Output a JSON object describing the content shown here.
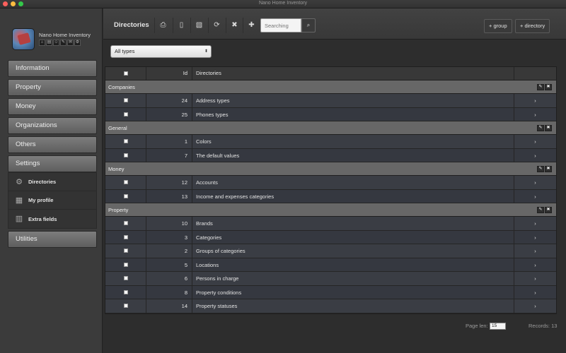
{
  "window": {
    "title": "Nano Home Inventory",
    "controls": [
      "close",
      "minimize",
      "maximize"
    ],
    "control_colors": [
      "#fc605c",
      "#fdbc40",
      "#34c84a"
    ]
  },
  "sidebar": {
    "app_name": "Nano Home Inventory",
    "quick_icons": [
      "home-icon",
      "building-icon",
      "users-icon",
      "wrench-icon",
      "chat-icon",
      "settings-icon"
    ],
    "quick_glyphs": [
      "⌂",
      "▤",
      "☺",
      "✎",
      "✉",
      "⚙"
    ],
    "menu": [
      {
        "label": "Information"
      },
      {
        "label": "Property"
      },
      {
        "label": "Money"
      },
      {
        "label": "Organizations"
      },
      {
        "label": "Others"
      },
      {
        "label": "Settings"
      },
      {
        "label": "Utilities"
      }
    ],
    "settings_submenu": [
      {
        "label": "Directories",
        "icon": "gears-icon",
        "glyph": "⚙"
      },
      {
        "label": "My profile",
        "icon": "grid-icon",
        "glyph": "▦"
      },
      {
        "label": "Extra fields",
        "icon": "form-icon",
        "glyph": "▥"
      }
    ]
  },
  "toolbar": {
    "title": "Directories",
    "buttons": [
      {
        "name": "print-icon",
        "glyph": "⎙"
      },
      {
        "name": "document-icon",
        "glyph": "▯"
      },
      {
        "name": "excel-icon",
        "glyph": "▧"
      },
      {
        "name": "refresh-icon",
        "glyph": "⟳"
      },
      {
        "name": "close-icon",
        "glyph": "✖"
      },
      {
        "name": "plus-icon",
        "glyph": "✚"
      }
    ],
    "search_placeholder": "Searching",
    "search_icon": "⌕",
    "add_group_label": "+ group",
    "add_directory_label": "+ directory"
  },
  "filter": {
    "selected": "All types",
    "arrow": "⬍"
  },
  "table": {
    "columns": {
      "id": "Id",
      "name": "Directories"
    },
    "row_action_glyph": "›",
    "edit_glyph": "✎",
    "delete_glyph": "✖",
    "groups": [
      {
        "name": "Companies",
        "rows": [
          {
            "id": "24",
            "name": "Address types"
          },
          {
            "id": "25",
            "name": "Phones types"
          }
        ]
      },
      {
        "name": "General",
        "rows": [
          {
            "id": "1",
            "name": "Colors"
          },
          {
            "id": "7",
            "name": "The default values"
          }
        ]
      },
      {
        "name": "Money",
        "rows": [
          {
            "id": "12",
            "name": "Accounts"
          },
          {
            "id": "13",
            "name": "Income and expenses categories"
          }
        ]
      },
      {
        "name": "Property",
        "rows": [
          {
            "id": "10",
            "name": "Brands"
          },
          {
            "id": "3",
            "name": "Categories"
          },
          {
            "id": "2",
            "name": "Groups of categories"
          },
          {
            "id": "5",
            "name": "Locations"
          },
          {
            "id": "6",
            "name": "Persons in charge"
          },
          {
            "id": "8",
            "name": "Property conditions"
          },
          {
            "id": "14",
            "name": "Property statuses"
          }
        ]
      }
    ]
  },
  "footer": {
    "page_len_label": "Page len:",
    "page_len_value": "15",
    "records_label": "Records: 13"
  }
}
